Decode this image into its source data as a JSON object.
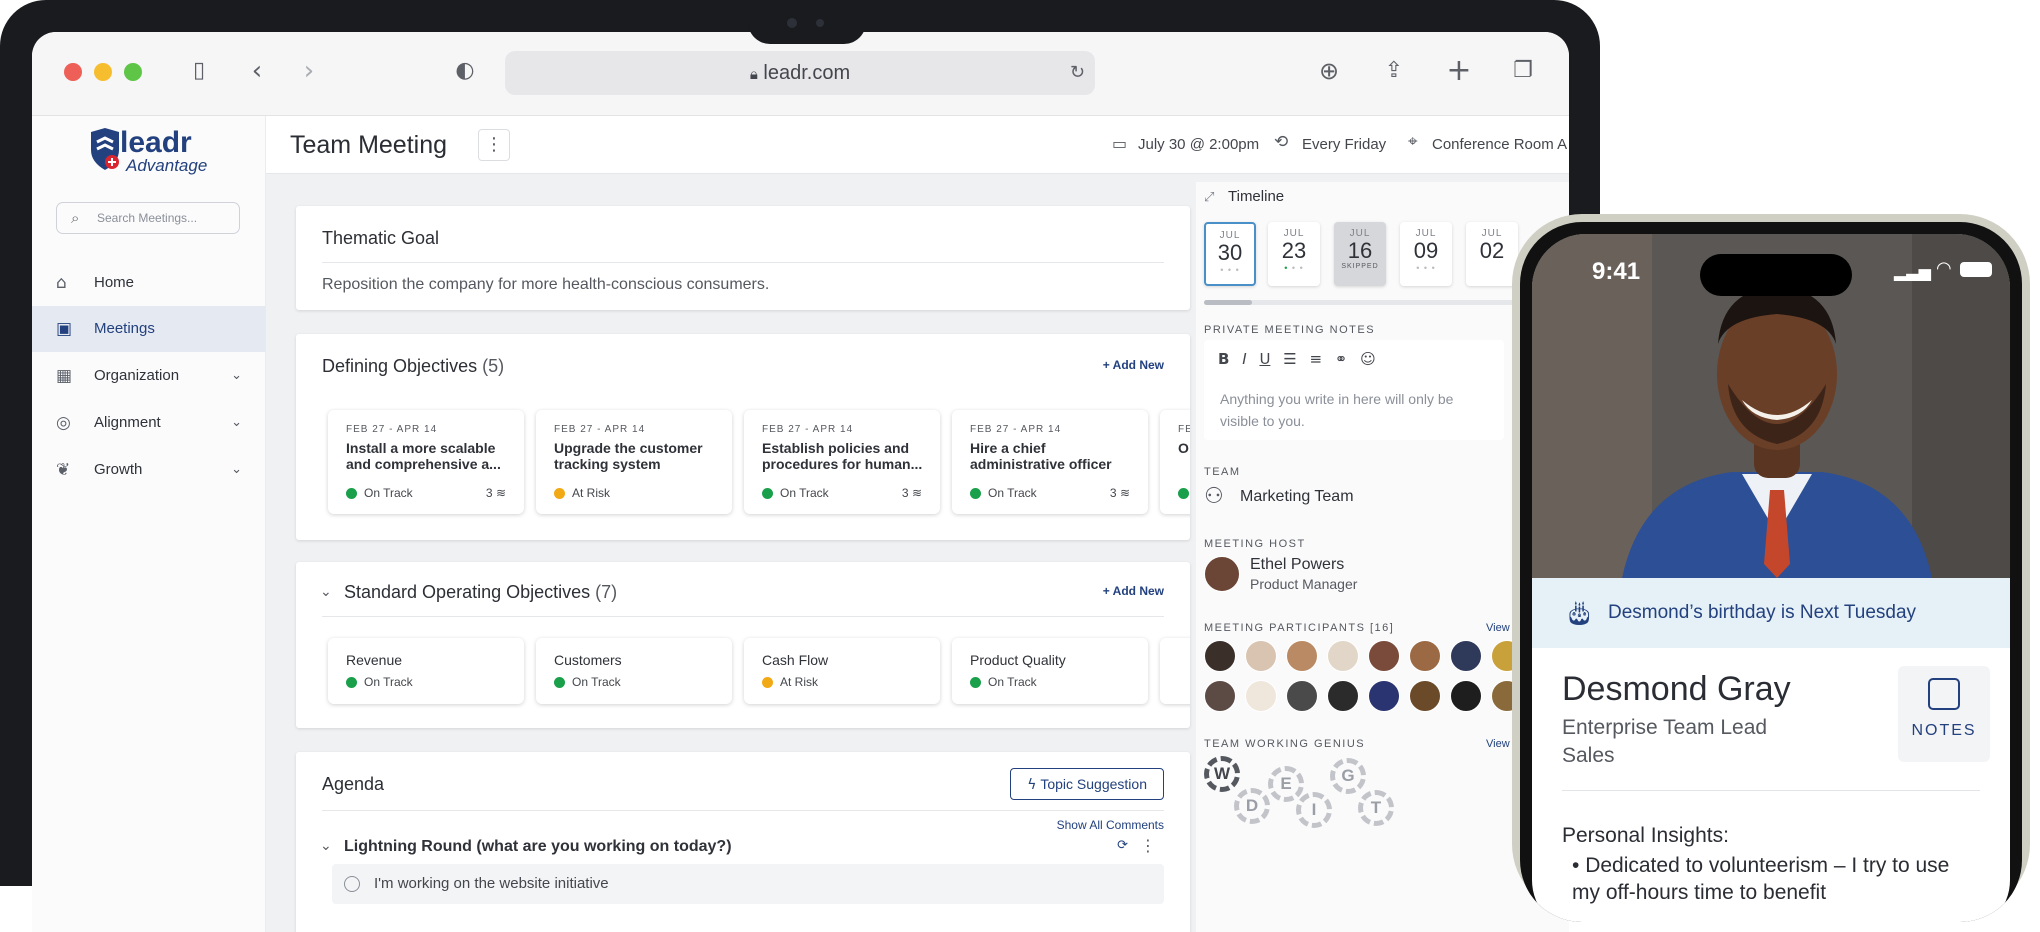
{
  "browser": {
    "url": "leadr.com"
  },
  "app": {
    "logo_text": "leadr",
    "logo_sub": "Advantage",
    "search_placeholder": "Search Meetings...",
    "nav": [
      {
        "label": "Home",
        "icon": "home-icon"
      },
      {
        "label": "Meetings",
        "icon": "briefcase-icon",
        "active": true
      },
      {
        "label": "Organization",
        "icon": "building-icon",
        "expandable": true
      },
      {
        "label": "Alignment",
        "icon": "compass-icon",
        "expandable": true
      },
      {
        "label": "Growth",
        "icon": "growth-icon",
        "expandable": true
      }
    ]
  },
  "meeting": {
    "title": "Team Meeting",
    "date": "July 30 @ 2:00pm",
    "recurrence": "Every Friday",
    "location": "Conference Room A"
  },
  "thematic_goal": {
    "title": "Thematic Goal",
    "text": "Reposition the company for more health-conscious consumers."
  },
  "defining_objectives": {
    "title": "Defining Objectives",
    "count": "(5)",
    "add_label": "+ Add New",
    "items": [
      {
        "dates": "FEB 27 - APR 14",
        "title": "Install a more scalable and comprehensive a...",
        "status": "On Track",
        "status_color": "#1aa04b",
        "count": "3"
      },
      {
        "dates": "FEB 27 - APR 14",
        "title": "Upgrade the customer tracking system",
        "status": "At Risk",
        "status_color": "#f2a916",
        "count": ""
      },
      {
        "dates": "FEB 27 - APR 14",
        "title": "Establish policies and procedures for human...",
        "status": "On Track",
        "status_color": "#1aa04b",
        "count": "3"
      },
      {
        "dates": "FEB 27 - APR 14",
        "title": "Hire a chief administrative officer",
        "status": "On Track",
        "status_color": "#1aa04b",
        "count": "3"
      },
      {
        "dates": "FE",
        "title": "O",
        "status": "",
        "status_color": "#1aa04b",
        "count": ""
      }
    ]
  },
  "sop_objectives": {
    "title": "Standard Operating Objectives",
    "count": "(7)",
    "add_label": "+ Add New",
    "items": [
      {
        "name": "Revenue",
        "status": "On Track",
        "status_color": "#1aa04b"
      },
      {
        "name": "Customers",
        "status": "On Track",
        "status_color": "#1aa04b"
      },
      {
        "name": "Cash Flow",
        "status": "At Risk",
        "status_color": "#f2a916"
      },
      {
        "name": "Product Quality",
        "status": "On Track",
        "status_color": "#1aa04b"
      }
    ]
  },
  "agenda": {
    "title": "Agenda",
    "topic_button": "Topic Suggestion",
    "show_comments": "Show All Comments",
    "section": "Lightning Round (what are you working on today?)",
    "item": "I'm working on the website initiative"
  },
  "timeline": {
    "title": "Timeline",
    "dates": [
      {
        "month": "JUL",
        "day": "30",
        "note": "",
        "selected": true
      },
      {
        "month": "JUL",
        "day": "23",
        "note": ""
      },
      {
        "month": "JUL",
        "day": "16",
        "note": "SKIPPED",
        "skipped": true
      },
      {
        "month": "JUL",
        "day": "09",
        "note": ""
      },
      {
        "month": "JUL",
        "day": "02",
        "note": ""
      }
    ]
  },
  "private_notes": {
    "label": "PRIVATE MEETING NOTES",
    "placeholder": "Anything you write in here will only be visible to you."
  },
  "team": {
    "label": "TEAM",
    "name": "Marketing Team"
  },
  "host": {
    "label": "MEETING HOST",
    "name": "Ethel Powers",
    "title": "Product Manager"
  },
  "participants": {
    "label": "MEETING PARTICIPANTS [16]",
    "view": "View"
  },
  "genius": {
    "label": "TEAM WORKING GENIUS",
    "view": "View",
    "letters": [
      "W",
      "D",
      "E",
      "I",
      "G",
      "T"
    ]
  },
  "phone": {
    "time": "9:41",
    "banner": "Desmond’s birthday is Next Tuesday",
    "name": "Desmond Gray",
    "role": "Enterprise Team Lead",
    "dept": "Sales",
    "notes_label": "NOTES",
    "insights_title": "Personal Insights:",
    "insight": "Dedicated to volunteerism – I try to use my off-hours time to benefit"
  }
}
